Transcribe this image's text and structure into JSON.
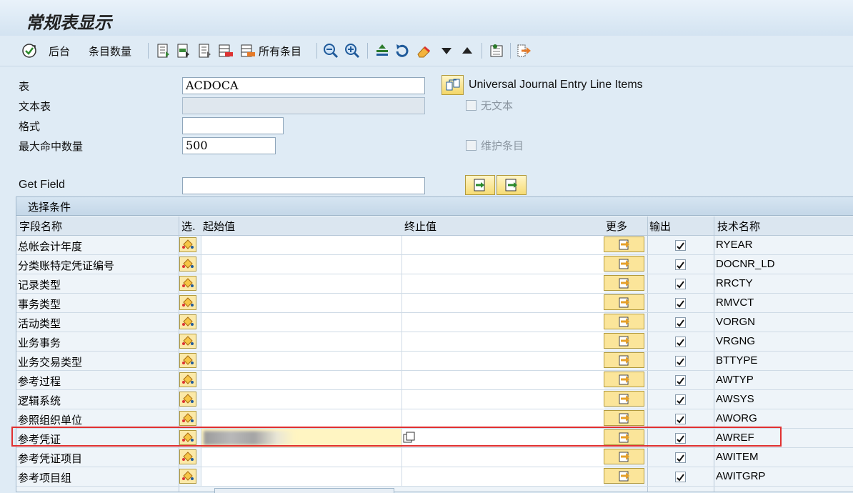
{
  "window": {
    "title": "常规表显示"
  },
  "toolbar": {
    "back_label": "后台",
    "count_label": "条目数量",
    "all_entries_label": "所有条目"
  },
  "form": {
    "table_label": "表",
    "table_value": "ACDOCA",
    "table_description": "Universal Journal Entry Line Items",
    "text_table_label": "文本表",
    "text_table_value": "",
    "no_text_label": "无文本",
    "format_label": "格式",
    "format_value": "",
    "max_hits_label": "最大命中数量",
    "max_hits_value": "500",
    "maintain_entries_label": "维护条目",
    "get_field_label": "Get Field",
    "get_field_value": ""
  },
  "selection": {
    "title": "选择条件",
    "columns": {
      "field_name": "字段名称",
      "select": "选.",
      "from": "起始值",
      "to": "终止值",
      "more": "更多",
      "output": "输出",
      "tech_name": "技术名称"
    },
    "rows": [
      {
        "name": "总帐会计年度",
        "tech": "RYEAR",
        "output": true
      },
      {
        "name": "分类账特定凭证编号",
        "tech": "DOCNR_LD",
        "output": true
      },
      {
        "name": "记录类型",
        "tech": "RRCTY",
        "output": true
      },
      {
        "name": "事务类型",
        "tech": "RMVCT",
        "output": true
      },
      {
        "name": "活动类型",
        "tech": "VORGN",
        "output": true
      },
      {
        "name": "业务事务",
        "tech": "VRGNG",
        "output": true
      },
      {
        "name": "业务交易类型",
        "tech": "BTTYPE",
        "output": true
      },
      {
        "name": "参考过程",
        "tech": "AWTYP",
        "output": true
      },
      {
        "name": "逻辑系统",
        "tech": "AWSYS",
        "output": true
      },
      {
        "name": "参照组织单位",
        "tech": "AWORG",
        "output": true
      },
      {
        "name": "参考凭证",
        "tech": "AWREF",
        "output": true,
        "highlighted": true
      },
      {
        "name": "参考凭证项目",
        "tech": "AWITEM",
        "output": true
      },
      {
        "name": "参考项目组",
        "tech": "AWITGRP",
        "output": true
      }
    ]
  },
  "colors": {
    "highlight": "#e03030",
    "background": "#dfebf5",
    "button_yellow": "#f6dc74"
  }
}
